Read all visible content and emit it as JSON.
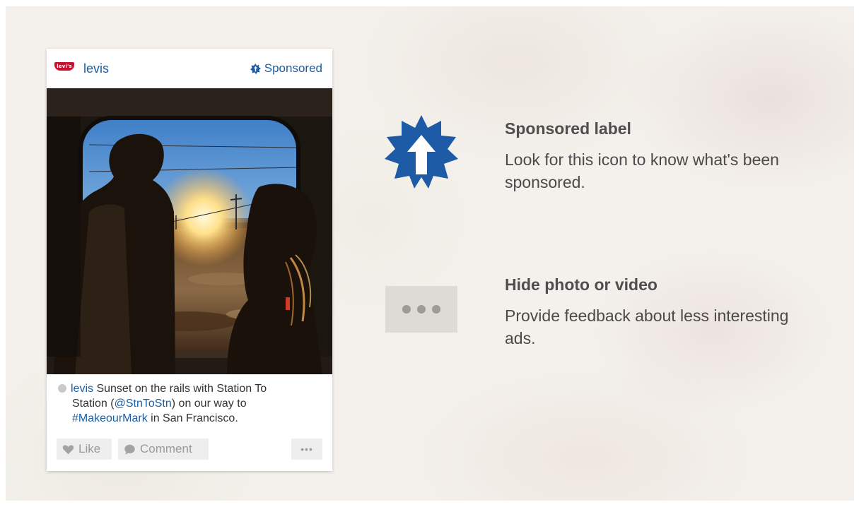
{
  "post": {
    "username": "levis",
    "logo_text": "levi's",
    "sponsored_label": "Sponsored",
    "caption": {
      "user": "levis",
      "text_1": " Sunset on the rails with Station To",
      "text_2a": "Station (",
      "mention": "@StnToStn",
      "text_2b": ") on our way to",
      "hashtag": "#MakeourMark",
      "text_3": " in San Francisco."
    },
    "actions": {
      "like": "Like",
      "comment": "Comment",
      "more": "•••"
    }
  },
  "features": [
    {
      "title": "Sponsored label",
      "description": "Look for this icon to know what's been sponsored.",
      "icon": "sponsored-badge-icon"
    },
    {
      "title": "Hide photo or video",
      "description": "Provide feedback about less interesting ads.",
      "icon": "more-options-icon"
    }
  ],
  "colors": {
    "link_blue": "#1a5ea3",
    "badge_blue": "#1d5ba6",
    "brand_red": "#c8102e"
  }
}
